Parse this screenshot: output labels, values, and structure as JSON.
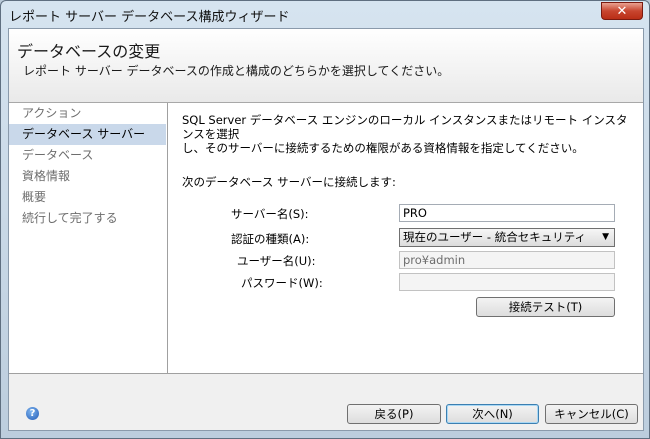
{
  "window": {
    "title": "レポート サーバー データベース構成ウィザード",
    "close_glyph": "✕"
  },
  "header": {
    "title": "データベースの変更",
    "subtitle": "レポート サーバー データベースの作成と構成のどちらかを選択してください。"
  },
  "nav": {
    "items": [
      {
        "label": "アクション",
        "selected": false
      },
      {
        "label": "データベース サーバー",
        "selected": true
      },
      {
        "label": "データベース",
        "selected": false
      },
      {
        "label": "資格情報",
        "selected": false
      },
      {
        "label": "概要",
        "selected": false
      },
      {
        "label": "続行して完了する",
        "selected": false
      }
    ]
  },
  "content": {
    "description_line1": "SQL Server データベース エンジンのローカル インスタンスまたはリモート インスタンスを選択",
    "description_line2": "し、そのサーバーに接続するための権限がある資格情報を指定してください。",
    "connect_label": "次のデータベース サーバーに接続します:",
    "server_name_label": "サーバー名(S):",
    "server_name_value": "PRO",
    "auth_type_label": "認証の種類(A):",
    "auth_type_value": "現在のユーザー - 統合セキュリティ",
    "username_label": "ユーザー名(U):",
    "username_value": "pro¥admin",
    "password_label": "パスワード(W):",
    "password_value": "",
    "test_connection_label": "接続テスト(T)"
  },
  "footer": {
    "help_glyph": "?",
    "back_label": "戻る(P)",
    "next_label": "次へ(N)",
    "cancel_label": "キャンセル(C)"
  },
  "colors": {
    "selected_nav_bg": "#c9d8ea",
    "close_button": "#c8452f",
    "window_frame": "#bccddd"
  },
  "icons": {
    "help": "help-icon",
    "dropdown": "chevron-down-icon",
    "close": "close-icon"
  }
}
